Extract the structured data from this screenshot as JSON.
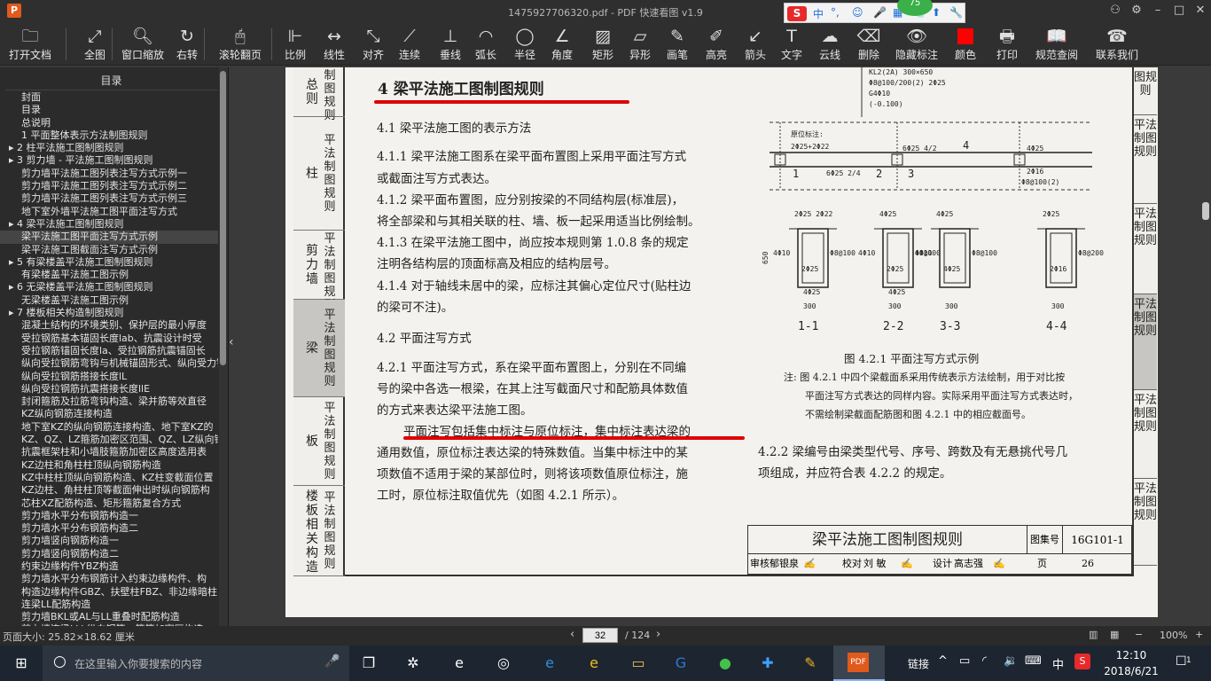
{
  "window": {
    "title": "1475927706320.pdf - PDF 快速看图 v1.9",
    "logo": "P"
  },
  "ime": {
    "items": [
      "中",
      "°,",
      "☺",
      "🎤",
      "▦",
      "👕",
      "⬆",
      "🔧"
    ],
    "badge": "75"
  },
  "toolbar": [
    {
      "id": "open",
      "label": "打开文档",
      "icon": "folder-icon",
      "glyph": "🗀"
    },
    {
      "id": "fit",
      "label": "全图",
      "icon": "fullscreen-icon",
      "glyph": "⤢"
    },
    {
      "id": "zoom",
      "label": "窗口缩放",
      "icon": "magnifier-icon",
      "glyph": "🔍︎"
    },
    {
      "id": "rotate",
      "label": "右转",
      "icon": "rotate-icon",
      "glyph": "↻"
    },
    {
      "id": "scroll",
      "label": "滚轮翻页",
      "icon": "mouse-icon",
      "glyph": "🖱"
    },
    {
      "id": "scale",
      "label": "比例",
      "icon": "ruler-icon",
      "glyph": "⊩"
    },
    {
      "id": "linear",
      "label": "线性",
      "icon": "linear-dim-icon",
      "glyph": "↔"
    },
    {
      "id": "align",
      "label": "对齐",
      "icon": "aligned-dim-icon",
      "glyph": "⤡"
    },
    {
      "id": "chain",
      "label": "连续",
      "icon": "continuous-dim-icon",
      "glyph": "⟋"
    },
    {
      "id": "perp",
      "label": "垂线",
      "icon": "perpendicular-icon",
      "glyph": "⊥"
    },
    {
      "id": "arc",
      "label": "弧长",
      "icon": "arc-length-icon",
      "glyph": "◠"
    },
    {
      "id": "radius",
      "label": "半径",
      "icon": "radius-icon",
      "glyph": "◯"
    },
    {
      "id": "angle",
      "label": "角度",
      "icon": "angle-icon",
      "glyph": "∠"
    },
    {
      "id": "rect",
      "label": "矩形",
      "icon": "rectangle-icon",
      "glyph": "▨"
    },
    {
      "id": "shape",
      "label": "异形",
      "icon": "polygon-icon",
      "glyph": "▱"
    },
    {
      "id": "pen",
      "label": "画笔",
      "icon": "pen-icon",
      "glyph": "✎"
    },
    {
      "id": "hl",
      "label": "高亮",
      "icon": "highlighter-icon",
      "glyph": "✐"
    },
    {
      "id": "arrow",
      "label": "箭头",
      "icon": "arrow-icon",
      "glyph": "↙"
    },
    {
      "id": "text",
      "label": "文字",
      "icon": "text-icon",
      "glyph": "T"
    },
    {
      "id": "cloud",
      "label": "云线",
      "icon": "cloud-line-icon",
      "glyph": "☁"
    },
    {
      "id": "erase",
      "label": "删除",
      "icon": "eraser-icon",
      "glyph": "⌫"
    },
    {
      "id": "hide",
      "label": "隐藏标注",
      "icon": "eye-hidden-icon",
      "glyph": "👁"
    },
    {
      "id": "color",
      "label": "颜色",
      "icon": "color-swatch-icon",
      "glyph": ""
    },
    {
      "id": "print",
      "label": "打印",
      "icon": "printer-icon",
      "glyph": "🖶"
    },
    {
      "id": "spec",
      "label": "规范查阅",
      "icon": "book-icon",
      "glyph": "📖"
    },
    {
      "id": "contact",
      "label": "联系我们",
      "icon": "headset-icon",
      "glyph": "☎"
    }
  ],
  "colors": {
    "annotation_red": "#ff0000",
    "underline_red": "#e00000",
    "app_accent": "#e05a1c"
  },
  "toc": {
    "heading": "目录",
    "items": [
      "封面",
      "目录",
      "总说明",
      "1 平面整体表示方法制图规则",
      "▸ 2 柱平法施工图制图规则",
      "▸ 3 剪力墙 - 平法施工图制图规则",
      "剪力墙平法施工图列表注写方式示例一",
      "剪力墙平法施工图列表注写方式示例二",
      "剪力墙平法施工图列表注写方式示例三",
      "地下室外墙平法施工图平面注写方式",
      "▸ 4 梁平法施工图制图规则",
      "梁平法施工图平面注写方式示例",
      "梁平法施工图截面注写方式示例",
      "▸ 5 有梁楼盖平法施工图制图规则",
      "有梁楼盖平法施工图示例",
      "▸ 6 无梁楼盖平法施工图制图规则",
      "无梁楼盖平法施工图示例",
      "▸ 7 楼板相关构造制图规则",
      "混凝土结构的环境类别、保护层的最小厚度",
      "受拉钢筋基本锚固长度lab、抗震设计时受",
      "受拉钢筋锚固长度la、受拉钢筋抗震锚固长",
      "纵向受拉钢筋弯钩与机械锚固形式、纵向受力钢",
      "纵向受拉钢筋搭接长度lL",
      "纵向受拉钢筋抗震搭接长度llE",
      "封闭箍筋及拉筋弯钩构造、梁并筋等效直径",
      "KZ纵向钢筋连接构造",
      "地下室KZ的纵向钢筋连接构造、地下室KZ的",
      "KZ、QZ、LZ箍筋加密区范围、QZ、LZ纵向钢",
      "抗震框架柱和小墙肢箍筋加密区高度选用表",
      "KZ边柱和角柱柱顶纵向钢筋构造",
      "KZ中柱柱顶纵向钢筋构造、KZ柱变截面位置",
      "KZ边柱、角柱柱顶等截面伸出时纵向钢筋构",
      "芯柱XZ配筋构造、矩形箍筋复合方式",
      "剪力墙水平分布钢筋构造一",
      "剪力墙水平分布钢筋构造二",
      "剪力墙竖向钢筋构造一",
      "剪力墙竖向钢筋构造二",
      "约束边缘构件YBZ构造",
      "剪力墙水平分布钢筋计入约束边缘构件、构",
      "构造边缘构件GBZ、扶壁柱FBZ、非边缘暗柱",
      "连梁LL配筋构造",
      "剪力墙BKL或AL与LL重叠时配筋构造",
      "剪力墙连梁LLk纵向钢筋、箍筋加密区构造"
    ],
    "selected_index": 11
  },
  "left_band": [
    {
      "a": "总则",
      "b": "制图规则"
    },
    {
      "a": "柱",
      "b": "平法制图规则"
    },
    {
      "a": "剪力墙",
      "b": "平法制图规则"
    },
    {
      "a": "梁",
      "b": "平法制图规则"
    },
    {
      "a": "板",
      "b": "平法制图规则"
    },
    {
      "a": "楼板相关构造",
      "b": "平法制图规则"
    }
  ],
  "right_band": [
    "图规则",
    "平法制图规则",
    "平法制图规则",
    "平法制图规则",
    "平法制图规则",
    "平法制图规则"
  ],
  "doc": {
    "heading": "4 梁平法施工图制图规则",
    "s41": "4.1 梁平法施工图的表示方法",
    "p411a": "4.1.1 梁平法施工图系在梁平面布置图上采用平面注写方式",
    "p411b": "或截面注写方式表达。",
    "p412a": "4.1.2 梁平面布置图，应分别按梁的不同结构层(标准层)，",
    "p412b": "将全部梁和与其相关联的柱、墙、板一起采用适当比例绘制。",
    "p413a": "4.1.3 在梁平法施工图中，尚应按本规则第 1.0.8 条的规定",
    "p413b": "注明各结构层的顶面标高及相应的结构层号。",
    "p414a": "4.1.4 对于轴线未居中的梁，应标注其偏心定位尺寸(贴柱边",
    "p414b": "的梁可不注)。",
    "s42": "4.2 平面注写方式",
    "p421a": "4.2.1 平面注写方式，系在梁平面布置图上，分别在不同编",
    "p421b": "号的梁中各选一根梁，在其上注写截面尺寸和配筋具体数值",
    "p421c": "的方式来表达梁平法施工图。",
    "p421d": "平面注写包括集中标注与原位标注，集中标注表达梁的",
    "p421e": "通用数值，原位标注表达梁的特殊数值。当集中标注中的某",
    "p421f": "项数值不适用于梁的某部位时，则将该项数值原位标注，施",
    "p421g": "工时，原位标注取值优先（如图 4.2.1 所示）。",
    "p422a": "4.2.2 梁编号由梁类型代号、序号、跨数及有无悬挑代号几",
    "p422b": "项组成，并应符合表 4.2.2 的规定。"
  },
  "figure": {
    "top_note": [
      "KL2(2A) 300×650",
      "Φ8@100/200(2) 2Φ25",
      "G4Φ10",
      "(-0.100)"
    ],
    "orig_label": "原位标注:",
    "orig_value": "2Φ25+2Φ22",
    "span_labels": [
      "6Φ25 4/2",
      "6Φ25 2/4",
      "4Φ25",
      "2Φ16",
      "Φ8@100(2)"
    ],
    "axis_marks": [
      "1",
      "2",
      "3",
      "4"
    ],
    "sections": [
      {
        "name": "1-1",
        "top": "2Φ25  2Φ22",
        "side": "4Φ10",
        "stirrup": "Φ8@100",
        "bot": "2Φ25",
        "bot2": "4Φ25",
        "w": "300"
      },
      {
        "name": "2-2",
        "top": "4Φ25",
        "side": "4Φ10",
        "stirrup": "Φ8@100",
        "bot": "2Φ25",
        "bot2": "4Φ25",
        "w": "300"
      },
      {
        "name": "3-3",
        "top": "4Φ25",
        "side": "4Φ10",
        "stirrup": "Φ8@100",
        "bot": "4Φ25",
        "bot2": "",
        "w": "300"
      },
      {
        "name": "4-4",
        "top": "2Φ25",
        "side": "",
        "stirrup": "Φ8@200",
        "bot": "2Φ16",
        "bot2": "",
        "w": "300"
      }
    ],
    "height_label": "650",
    "caption": "图 4.2.1   平面注写方式示例",
    "note1": "注: 图 4.2.1 中四个梁截面系采用传统表示方法绘制，用于对比按",
    "note2": "平面注写方式表达的同样内容。实际采用平面注写方式表达时，",
    "note3": "不需绘制梁截面配筋图和图 4.2.1 中的相应截面号。"
  },
  "titleblock": {
    "title": "梁平法施工图制图规则",
    "set_label": "图集号",
    "set_no": "16G101-1",
    "review": "审核",
    "reviewer": "郁银泉",
    "check": "校对",
    "checker": "刘 敏",
    "design": "设计",
    "designer": "高志强",
    "page_label": "页",
    "page_no": "26"
  },
  "status": {
    "page_size": "页面大小: 25.82×18.62 厘米",
    "current_page": "32",
    "total": "/ 124",
    "zoom": "100%"
  },
  "taskbar": {
    "search_placeholder": "在这里输入你要搜索的内容",
    "link_label": "链接",
    "ime": "中",
    "time": "12:10",
    "date": "2018/6/21",
    "notify": "1"
  }
}
